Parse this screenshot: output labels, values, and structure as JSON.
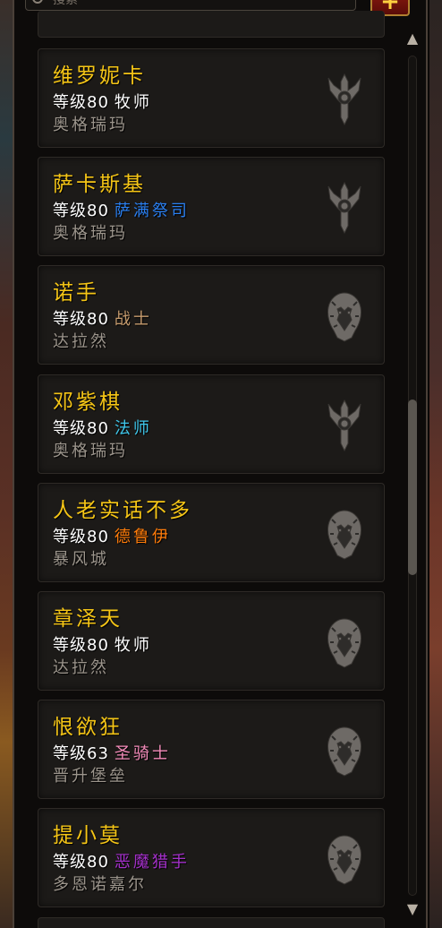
{
  "search": {
    "placeholder": "搜索"
  },
  "add_button": {
    "label": "+"
  },
  "colors": {
    "name": "#f5c516",
    "realm": "#9c958c",
    "level": "#ffffff"
  },
  "characters": [
    {
      "name": "维罗妮卡",
      "level_text": "等级80",
      "class": "牧师",
      "class_color": "#ffffff",
      "realm": "奥格瑞玛",
      "faction": "horde-icon"
    },
    {
      "name": "萨卡斯基",
      "level_text": "等级80",
      "class": "萨满祭司",
      "class_color": "#2a7ff0",
      "realm": "奥格瑞玛",
      "faction": "horde-icon"
    },
    {
      "name": "诺手",
      "level_text": "等级80",
      "class": "战士",
      "class_color": "#c69b6d",
      "realm": "达拉然",
      "faction": "alliance-icon"
    },
    {
      "name": "邓紫棋",
      "level_text": "等级80",
      "class": "法师",
      "class_color": "#3fc7eb",
      "realm": "奥格瑞玛",
      "faction": "horde-icon"
    },
    {
      "name": "人老实话不多",
      "level_text": "等级80",
      "class": "德鲁伊",
      "class_color": "#ff7c0a",
      "realm": "暴风城",
      "faction": "alliance-icon"
    },
    {
      "name": "章泽天",
      "level_text": "等级80",
      "class": "牧师",
      "class_color": "#ffffff",
      "realm": "达拉然",
      "faction": "alliance-icon"
    },
    {
      "name": "恨欲狂",
      "level_text": "等级63",
      "class": "圣骑士",
      "class_color": "#f48cba",
      "realm": "晋升堡垒",
      "faction": "alliance-icon"
    },
    {
      "name": "提小莫",
      "level_text": "等级80",
      "class": "恶魔猎手",
      "class_color": "#a330c9",
      "realm": "多恩诺嘉尔",
      "faction": "alliance-icon"
    }
  ],
  "scrollbar": {
    "up": "▲",
    "down": "▼"
  }
}
